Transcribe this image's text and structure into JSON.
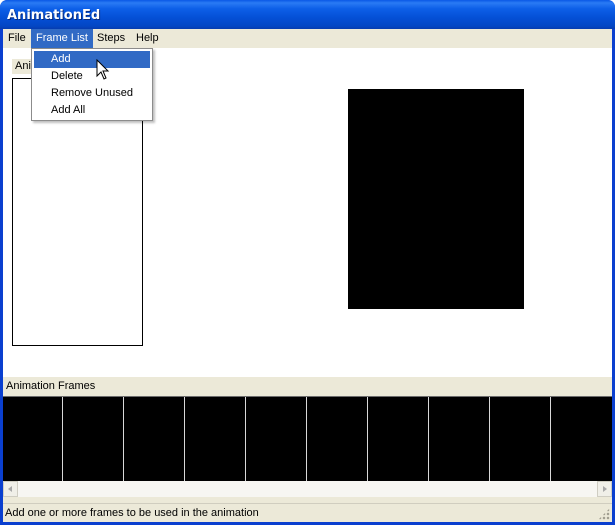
{
  "window": {
    "title": "AnimationEd"
  },
  "menubar": {
    "items": [
      {
        "label": "File"
      },
      {
        "label": "Frame List"
      },
      {
        "label": "Steps"
      },
      {
        "label": "Help"
      }
    ],
    "active": "Frame List"
  },
  "frame_list_menu": {
    "items": [
      {
        "label": "Add",
        "highlighted": true
      },
      {
        "label": "Delete"
      },
      {
        "label": "Remove Unused"
      },
      {
        "label": "Add All"
      }
    ]
  },
  "frame_list_group": {
    "label_visible": "Ani"
  },
  "frames_panel": {
    "header": "Animation Frames"
  },
  "scrollbar": {
    "left_icon": "arrow-left-icon",
    "right_icon": "arrow-right-icon"
  },
  "statusbar": {
    "text": "Add one or more frames to be used in the animation"
  },
  "colors": {
    "titlebar": "#0a58e6",
    "menu_highlight": "#316ac5",
    "window_bg": "#ece9d8",
    "preview": "#000000"
  }
}
